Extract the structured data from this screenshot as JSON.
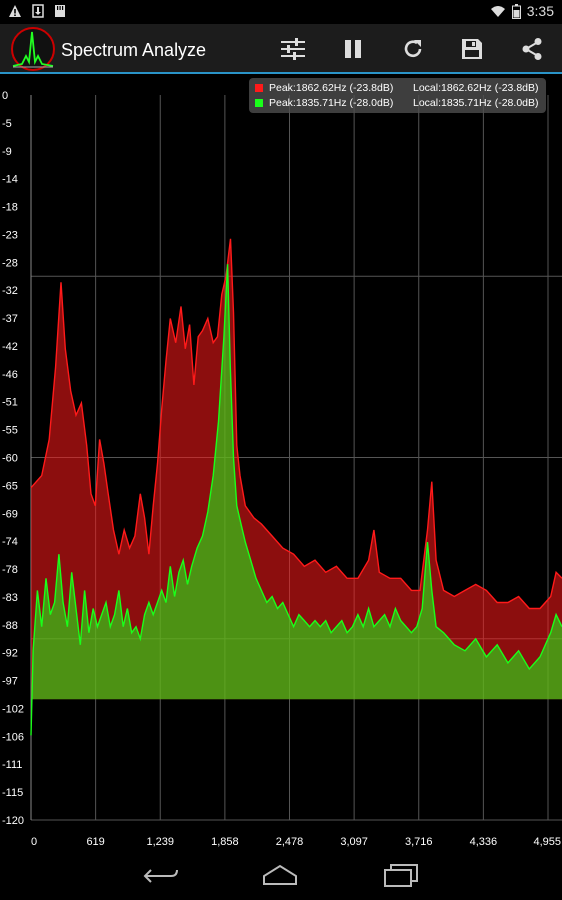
{
  "status_bar": {
    "time": "3:35"
  },
  "app": {
    "title": "Spectrum Analyze"
  },
  "toolbar": {
    "buttons": [
      "settings-sliders-icon",
      "pause-icon",
      "refresh-icon",
      "save-icon",
      "share-icon"
    ]
  },
  "legend": {
    "entries": [
      {
        "peak": "Peak:1862.62Hz (-23.8dB)",
        "local": "Local:1862.62Hz (-23.8dB)",
        "color": "#ff1a1a"
      },
      {
        "peak": "Peak:1835.71Hz (-28.0dB)",
        "local": "Local:1835.71Hz (-28.0dB)",
        "color": "#1aff1a"
      }
    ]
  },
  "colors": {
    "accent": "#2a94c8",
    "red_series": "#ff1a1a",
    "green_series": "#1aff1a",
    "grid": "#555555"
  },
  "nav": {
    "buttons": [
      "back-icon",
      "home-icon",
      "recent-apps-icon"
    ]
  },
  "chart_data": {
    "type": "area",
    "yticks": [
      "0",
      "-5",
      "-9",
      "-14",
      "-18",
      "-23",
      "-28",
      "-32",
      "-37",
      "-42",
      "-46",
      "-51",
      "-55",
      "-60",
      "-65",
      "-69",
      "-74",
      "-78",
      "-83",
      "-88",
      "-92",
      "-97",
      "-102",
      "-106",
      "-111",
      "-115",
      "-120"
    ],
    "xticks": [
      "0",
      "619",
      "1,239",
      "1,858",
      "2,478",
      "3,097",
      "3,716",
      "4,336",
      "4,955"
    ],
    "ylim": [
      -120,
      0
    ],
    "xlim": [
      0,
      4955
    ],
    "series": [
      {
        "name": "Peak:1862.62Hz (-23.8dB)",
        "color": "#ff1a1a",
        "points": [
          [
            0,
            -65
          ],
          [
            100,
            -63
          ],
          [
            170,
            -57
          ],
          [
            230,
            -45
          ],
          [
            280,
            -31
          ],
          [
            320,
            -42
          ],
          [
            370,
            -49
          ],
          [
            420,
            -53
          ],
          [
            470,
            -51
          ],
          [
            520,
            -58
          ],
          [
            560,
            -66
          ],
          [
            600,
            -68
          ],
          [
            640,
            -57
          ],
          [
            680,
            -61
          ],
          [
            720,
            -66
          ],
          [
            770,
            -72
          ],
          [
            820,
            -76
          ],
          [
            870,
            -72
          ],
          [
            920,
            -75
          ],
          [
            970,
            -73
          ],
          [
            1020,
            -66
          ],
          [
            1060,
            -70
          ],
          [
            1100,
            -76
          ],
          [
            1140,
            -68
          ],
          [
            1180,
            -61
          ],
          [
            1220,
            -52
          ],
          [
            1260,
            -44
          ],
          [
            1300,
            -37
          ],
          [
            1350,
            -41
          ],
          [
            1400,
            -35
          ],
          [
            1440,
            -42
          ],
          [
            1480,
            -38
          ],
          [
            1520,
            -48
          ],
          [
            1560,
            -40
          ],
          [
            1600,
            -39
          ],
          [
            1650,
            -37
          ],
          [
            1700,
            -41
          ],
          [
            1740,
            -40
          ],
          [
            1780,
            -33
          ],
          [
            1820,
            -30
          ],
          [
            1862,
            -23.8
          ],
          [
            1890,
            -36
          ],
          [
            1920,
            -58
          ],
          [
            1950,
            -63
          ],
          [
            2000,
            -68
          ],
          [
            2080,
            -70
          ],
          [
            2150,
            -71
          ],
          [
            2250,
            -73
          ],
          [
            2350,
            -75
          ],
          [
            2450,
            -76
          ],
          [
            2550,
            -78
          ],
          [
            2650,
            -77
          ],
          [
            2750,
            -79
          ],
          [
            2850,
            -78
          ],
          [
            2950,
            -80
          ],
          [
            3050,
            -80
          ],
          [
            3150,
            -77
          ],
          [
            3200,
            -72
          ],
          [
            3250,
            -79
          ],
          [
            3350,
            -80
          ],
          [
            3450,
            -80
          ],
          [
            3550,
            -82
          ],
          [
            3630,
            -82
          ],
          [
            3700,
            -72
          ],
          [
            3740,
            -64
          ],
          [
            3780,
            -77
          ],
          [
            3850,
            -82
          ],
          [
            3950,
            -83
          ],
          [
            4050,
            -82
          ],
          [
            4150,
            -81
          ],
          [
            4250,
            -82
          ],
          [
            4350,
            -84
          ],
          [
            4450,
            -84
          ],
          [
            4550,
            -83
          ],
          [
            4650,
            -85
          ],
          [
            4750,
            -85
          ],
          [
            4850,
            -83
          ],
          [
            4900,
            -79
          ],
          [
            4955,
            -80
          ]
        ]
      },
      {
        "name": "Peak:1835.71Hz (-28.0dB)",
        "color": "#1aff1a",
        "points": [
          [
            0,
            -106
          ],
          [
            20,
            -92
          ],
          [
            60,
            -82
          ],
          [
            100,
            -88
          ],
          [
            140,
            -80
          ],
          [
            180,
            -86
          ],
          [
            220,
            -84
          ],
          [
            260,
            -76
          ],
          [
            300,
            -84
          ],
          [
            340,
            -88
          ],
          [
            380,
            -79
          ],
          [
            420,
            -85
          ],
          [
            460,
            -91
          ],
          [
            500,
            -82
          ],
          [
            540,
            -89
          ],
          [
            580,
            -85
          ],
          [
            620,
            -88
          ],
          [
            660,
            -86
          ],
          [
            700,
            -84
          ],
          [
            740,
            -88
          ],
          [
            780,
            -86
          ],
          [
            820,
            -82
          ],
          [
            860,
            -88
          ],
          [
            900,
            -85
          ],
          [
            940,
            -89
          ],
          [
            980,
            -88
          ],
          [
            1020,
            -90
          ],
          [
            1060,
            -86
          ],
          [
            1100,
            -84
          ],
          [
            1140,
            -86
          ],
          [
            1180,
            -84
          ],
          [
            1220,
            -82
          ],
          [
            1260,
            -84
          ],
          [
            1300,
            -78
          ],
          [
            1340,
            -83
          ],
          [
            1380,
            -79
          ],
          [
            1420,
            -77
          ],
          [
            1460,
            -81
          ],
          [
            1500,
            -78
          ],
          [
            1550,
            -75
          ],
          [
            1600,
            -73
          ],
          [
            1650,
            -69
          ],
          [
            1700,
            -63
          ],
          [
            1750,
            -54
          ],
          [
            1800,
            -40
          ],
          [
            1835,
            -28
          ],
          [
            1860,
            -45
          ],
          [
            1890,
            -60
          ],
          [
            1920,
            -68
          ],
          [
            1960,
            -71
          ],
          [
            2000,
            -74
          ],
          [
            2050,
            -77
          ],
          [
            2100,
            -80
          ],
          [
            2150,
            -82
          ],
          [
            2200,
            -84
          ],
          [
            2250,
            -83
          ],
          [
            2300,
            -85
          ],
          [
            2350,
            -84
          ],
          [
            2400,
            -86
          ],
          [
            2450,
            -88
          ],
          [
            2500,
            -86
          ],
          [
            2550,
            -87
          ],
          [
            2600,
            -88
          ],
          [
            2650,
            -87
          ],
          [
            2700,
            -88
          ],
          [
            2750,
            -87
          ],
          [
            2800,
            -89
          ],
          [
            2850,
            -88
          ],
          [
            2900,
            -87
          ],
          [
            2950,
            -89
          ],
          [
            3000,
            -88
          ],
          [
            3050,
            -86
          ],
          [
            3100,
            -88
          ],
          [
            3150,
            -85
          ],
          [
            3200,
            -88
          ],
          [
            3250,
            -87
          ],
          [
            3300,
            -86
          ],
          [
            3350,
            -88
          ],
          [
            3400,
            -85
          ],
          [
            3450,
            -87
          ],
          [
            3500,
            -88
          ],
          [
            3550,
            -89
          ],
          [
            3600,
            -88
          ],
          [
            3650,
            -85
          ],
          [
            3700,
            -74
          ],
          [
            3740,
            -82
          ],
          [
            3780,
            -88
          ],
          [
            3850,
            -89
          ],
          [
            3950,
            -91
          ],
          [
            4050,
            -92
          ],
          [
            4150,
            -90
          ],
          [
            4250,
            -93
          ],
          [
            4350,
            -91
          ],
          [
            4450,
            -94
          ],
          [
            4550,
            -92
          ],
          [
            4650,
            -95
          ],
          [
            4750,
            -93
          ],
          [
            4850,
            -89
          ],
          [
            4900,
            -86
          ],
          [
            4955,
            -88
          ]
        ]
      }
    ],
    "grid": true,
    "legend_position": "top-right"
  }
}
